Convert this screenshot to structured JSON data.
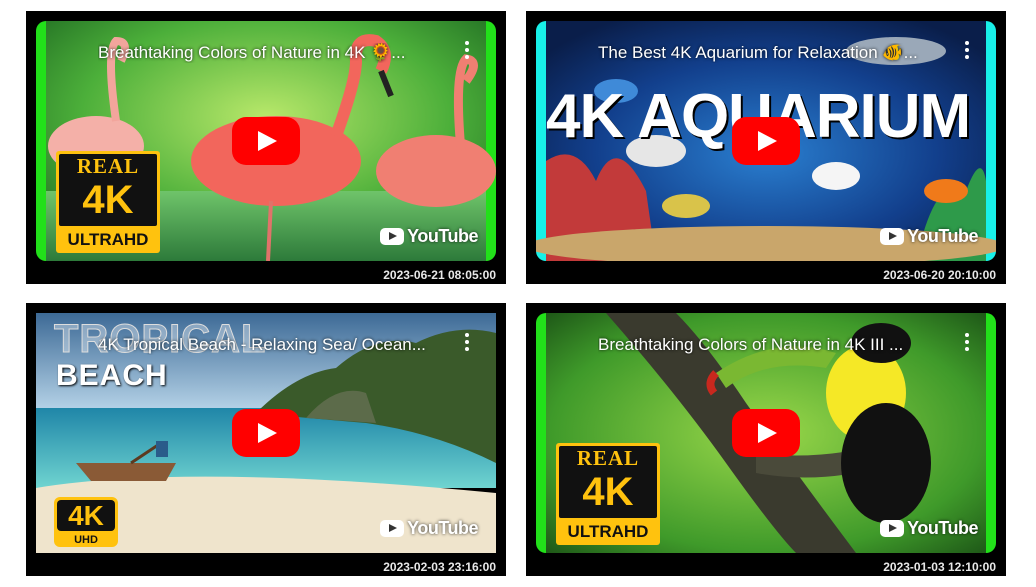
{
  "videos": [
    {
      "title": "Breathtaking Colors of Nature in 4K 🌻...",
      "timestamp": "2023-06-21 08:05:00",
      "badge_top": "REAL",
      "badge_main": "4K",
      "badge_bottom": "ULTRAHD"
    },
    {
      "title": "The Best 4K Aquarium for Relaxation 🐠...",
      "timestamp": "2023-06-20 20:10:00",
      "overlay_text": "4K AQUARIUM"
    },
    {
      "title": "4K Tropical Beach - Relaxing Sea/ Ocean...",
      "timestamp": "2023-02-03 23:16:00",
      "overlay_line1": "TROPICAL",
      "overlay_line2": "BEACH",
      "badge_main": "4K",
      "badge_bottom": "UHD"
    },
    {
      "title": "Breathtaking Colors of Nature in 4K III ...",
      "timestamp": "2023-01-03 12:10:00",
      "badge_top": "REAL",
      "badge_main": "4K",
      "badge_bottom": "ULTRAHD"
    }
  ],
  "youtube_label": "YouTube",
  "colors": {
    "frame_green": "#22e01a",
    "frame_cyan": "#18f0e8",
    "play_red": "#ff0000",
    "badge_gold": "#ffc20e"
  },
  "icons": [
    "play-button-icon",
    "more-vert-icon",
    "youtube-logo-icon"
  ]
}
